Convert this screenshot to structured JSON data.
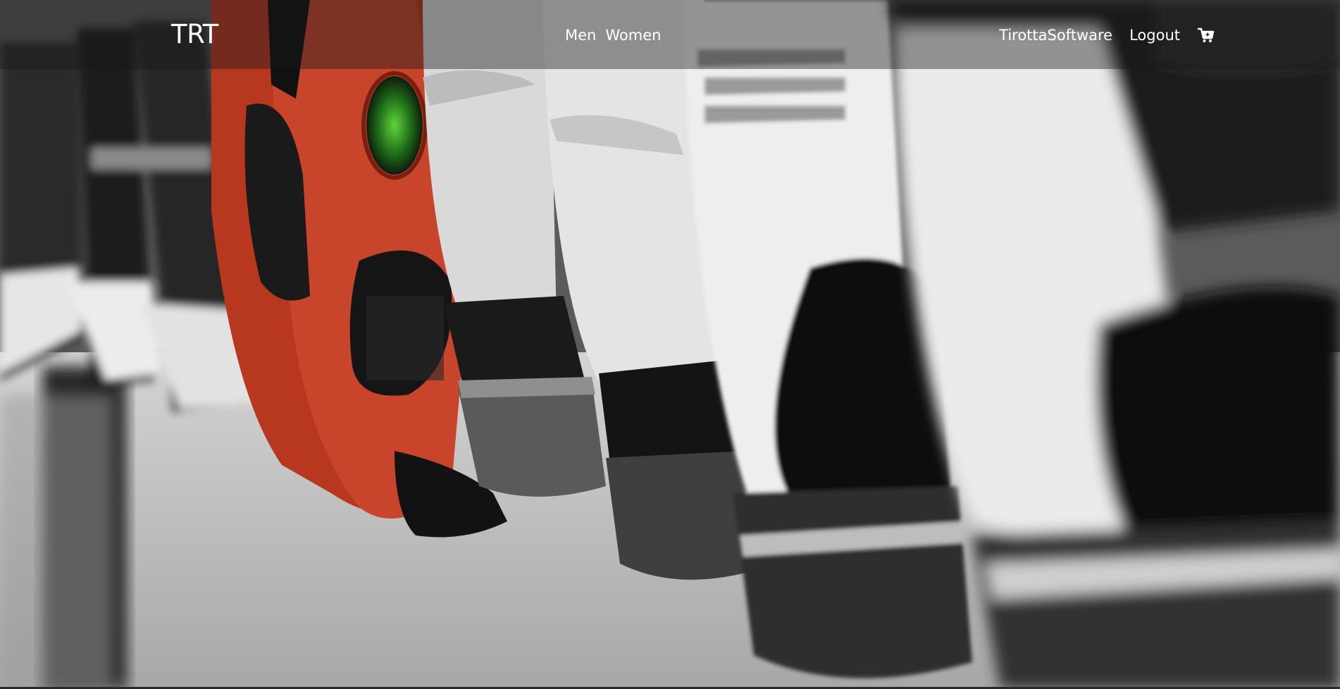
{
  "brand": {
    "name": "TRT"
  },
  "nav": {
    "left_links": [
      {
        "label": "Men"
      },
      {
        "label": "Women"
      }
    ],
    "right_links": [
      {
        "label": "TirottaSoftware"
      },
      {
        "label": "Logout"
      }
    ],
    "cart_icon": "shopping-cart-add-icon"
  },
  "hero": {
    "image_subject": "row of basketball sneakers, red suede shoe in focus, others blurred black-and-white",
    "colors": {
      "accent_red": "#c2402a",
      "accent_green": "#3cb02a",
      "nav_overlay": "#181818"
    }
  }
}
